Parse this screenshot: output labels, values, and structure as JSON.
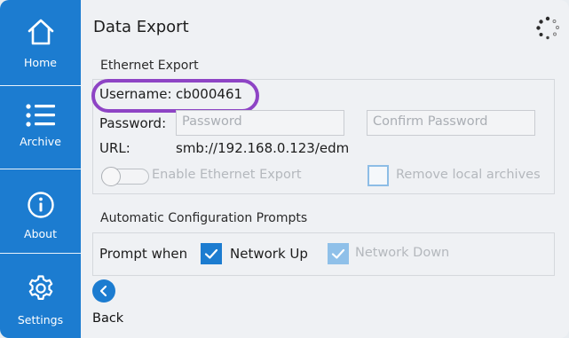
{
  "sidebar": {
    "items": [
      {
        "label": "Home",
        "icon": "home-icon"
      },
      {
        "label": "Archive",
        "icon": "list-icon"
      },
      {
        "label": "About",
        "icon": "info-icon"
      },
      {
        "label": "Settings",
        "icon": "gear-icon"
      }
    ],
    "color": "#1c7cd0"
  },
  "page": {
    "title": "Data Export",
    "status_icon": "loading-spinner-icon"
  },
  "ethernet": {
    "section_label": "Ethernet Export",
    "username_label": "Username:",
    "username_value": "cb000461",
    "password_label": "Password:",
    "password_placeholder": "Password",
    "confirm_placeholder": "Confirm Password",
    "url_label": "URL:",
    "url_value": "smb://192.168.0.123/edm",
    "enable_label": "Enable Ethernet Export",
    "enable_on": false,
    "remove_label": "Remove local archives",
    "remove_checked": false
  },
  "prompts": {
    "section_label": "Automatic Configuration Prompts",
    "prompt_when_label": "Prompt when",
    "network_up_label": "Network Up",
    "network_up_checked": true,
    "network_down_label": "Network Down",
    "network_down_checked": true
  },
  "footer": {
    "back_label": "Back"
  },
  "highlight_color": "#8e44c5"
}
